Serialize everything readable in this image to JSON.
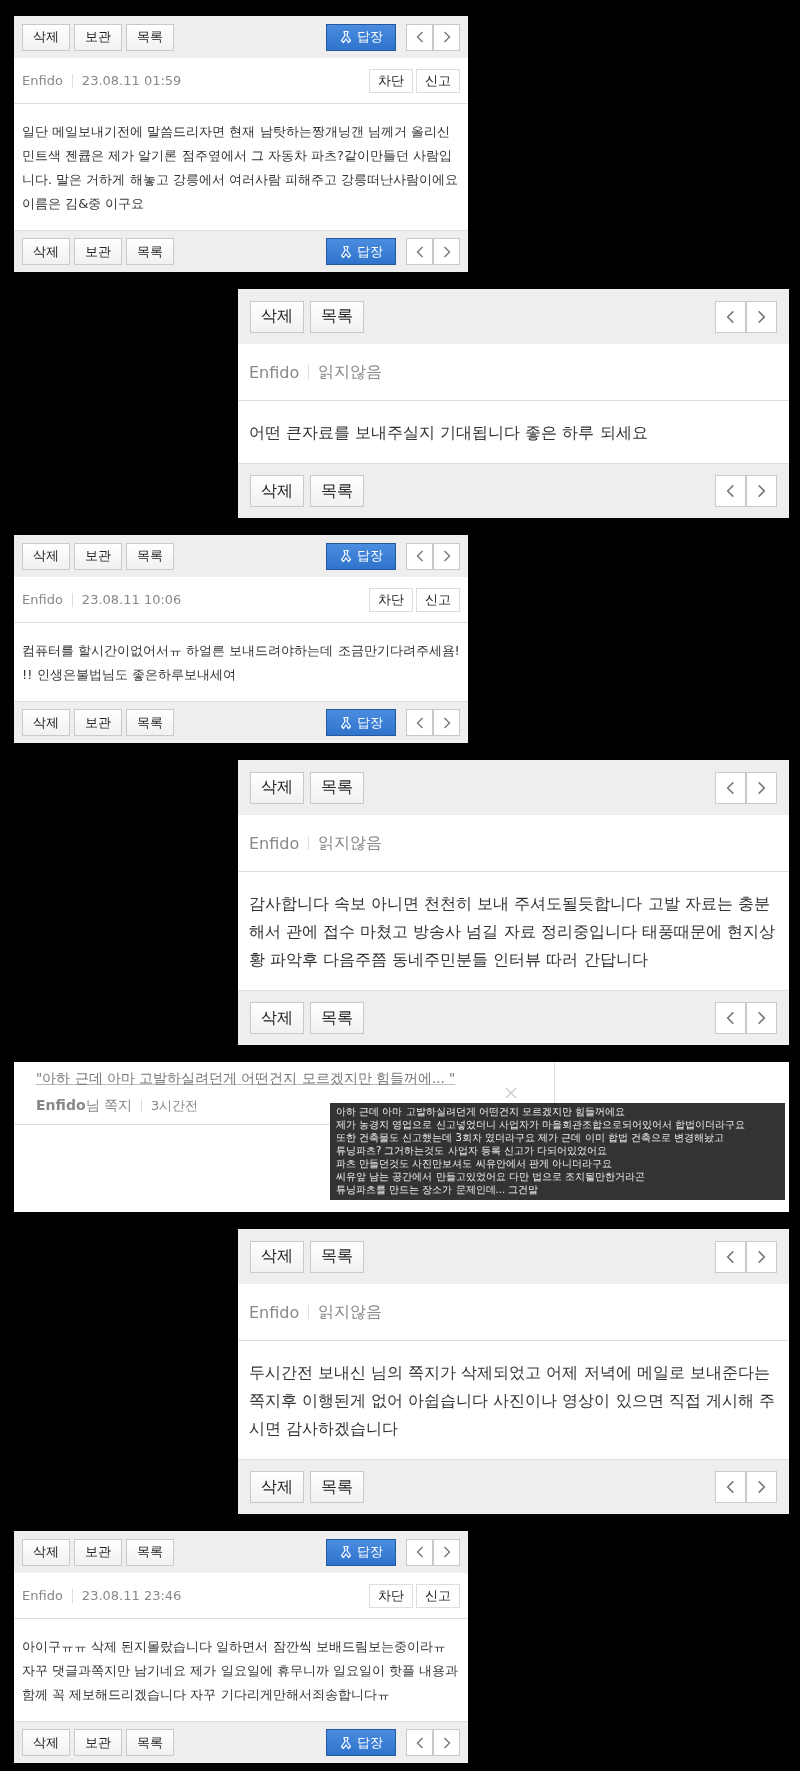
{
  "messages": [
    {
      "kind": "sent",
      "top_toolbar": {
        "buttons": [
          "삭제",
          "보관",
          "목록"
        ],
        "reply": "답장"
      },
      "sender": "Enfido",
      "date": "23.08.11 01:59",
      "actions": [
        "차단",
        "신고"
      ],
      "body": "일단 메일보내기전에 말씀드리자면 현재 남탓하는짱개닝갠 님께거 올리신 민트색 젠큡은 제가 알기론 점주옆에서 그 자동차 파츠?같이만들던 사람입니다. 말은 거하게 해놓고 강릉에서 여러사람 피해주고 강릉떠난사람이에요 이름은 김&중 이구요",
      "bottom_toolbar": {
        "buttons": [
          "삭제",
          "보관",
          "목록"
        ],
        "reply": "답장"
      }
    },
    {
      "kind": "received",
      "top_toolbar": {
        "buttons": [
          "삭제",
          "목록"
        ]
      },
      "sender": "Enfido",
      "status": "읽지않음",
      "body": "어떤 큰자료를 보내주실지 기대됩니다 좋은 하루 되세요",
      "bottom_toolbar": {
        "buttons": [
          "삭제",
          "목록"
        ]
      }
    },
    {
      "kind": "sent",
      "top_toolbar": {
        "buttons": [
          "삭제",
          "보관",
          "목록"
        ],
        "reply": "답장"
      },
      "sender": "Enfido",
      "date": "23.08.11 10:06",
      "actions": [
        "차단",
        "신고"
      ],
      "body": "컴퓨터를 할시간이없어서ㅠ 하얼른 보내드려야하는데 조금만기다려주세욤!!! 인생은불법님도 좋은하루보내세여",
      "bottom_toolbar": {
        "buttons": [
          "삭제",
          "보관",
          "목록"
        ],
        "reply": "답장"
      }
    },
    {
      "kind": "received",
      "top_toolbar": {
        "buttons": [
          "삭제",
          "목록"
        ]
      },
      "sender": "Enfido",
      "status": "읽지않음",
      "body": "감사합니다 속보 아니면 천천히 보내 주셔도될듯합니다 고발 자료는 충분해서 관에 접수 마쳤고 방송사 넘길 자료 정리중입니다 태풍때문에 현지상황 파악후 다음주쯤 동네주민분들 인터뷰 따러 간답니다",
      "bottom_toolbar": {
        "buttons": [
          "삭제",
          "목록"
        ]
      }
    },
    {
      "kind": "notification",
      "quote": "\"아하 근데 아마 고발하실려던게 어떤건지 모르겠지만 힘들꺼에...  \"",
      "sender": "**Enfido**님 쪽지",
      "time": "3시간전",
      "tooltip_lines": [
        "아하 근데 아마 고발하실려던게 어떤건지 모르겠지만 힘들꺼에요",
        "제가 농경지 영업으로 신고넣었더니 사업자가 마을회관조합으로되어있어서 합법이더라구요",
        "또한 건축물도 신고했는데 3회차 였더라구요 제가 근데 이미 합법 건축으로 변경해놨고",
        "튜닝파츠? 그거하는것도 사업자 등록 신고가 다되어있었어요",
        "파츠 만들던것도 사진만보셔도 씨유안에서 판게 아니더라구요",
        "씨유앞 남는 공간에서 만들고있었어요 다만 법으로 조치될만한거라곤",
        "튜닝파츠를 만드는 장소가 문제인데... 그건말"
      ]
    },
    {
      "kind": "received",
      "top_toolbar": {
        "buttons": [
          "삭제",
          "목록"
        ]
      },
      "sender": "Enfido",
      "status": "읽지않음",
      "body": "두시간전 보내신 님의 쪽지가 삭제되었고 어제 저녁에 메일로 보내준다는 쪽지후 이행된게 없어 아쉽습니다 사진이나 영상이 있으면 직접 게시해 주시면 감사하겠습니다",
      "bottom_toolbar": {
        "buttons": [
          "삭제",
          "목록"
        ]
      }
    },
    {
      "kind": "sent",
      "top_toolbar": {
        "buttons": [
          "삭제",
          "보관",
          "목록"
        ],
        "reply": "답장"
      },
      "sender": "Enfido",
      "date": "23.08.11 23:46",
      "actions": [
        "차단",
        "신고"
      ],
      "body": "아이구ㅠㅠ 삭제 된지몰랐습니다 일하면서 잠깐씩 보배드림보는중이라ㅠ 자꾸 댓글과쪽지만 남기네요 제가 일요일에 휴무니까 일요일이 핫플 내용과함께 꼭 제보해드리겠습니다 자꾸 기다리게만해서죄송합니다ㅠ",
      "bottom_toolbar": {
        "buttons": [
          "삭제",
          "보관",
          "목록"
        ],
        "reply": "답장"
      }
    }
  ]
}
